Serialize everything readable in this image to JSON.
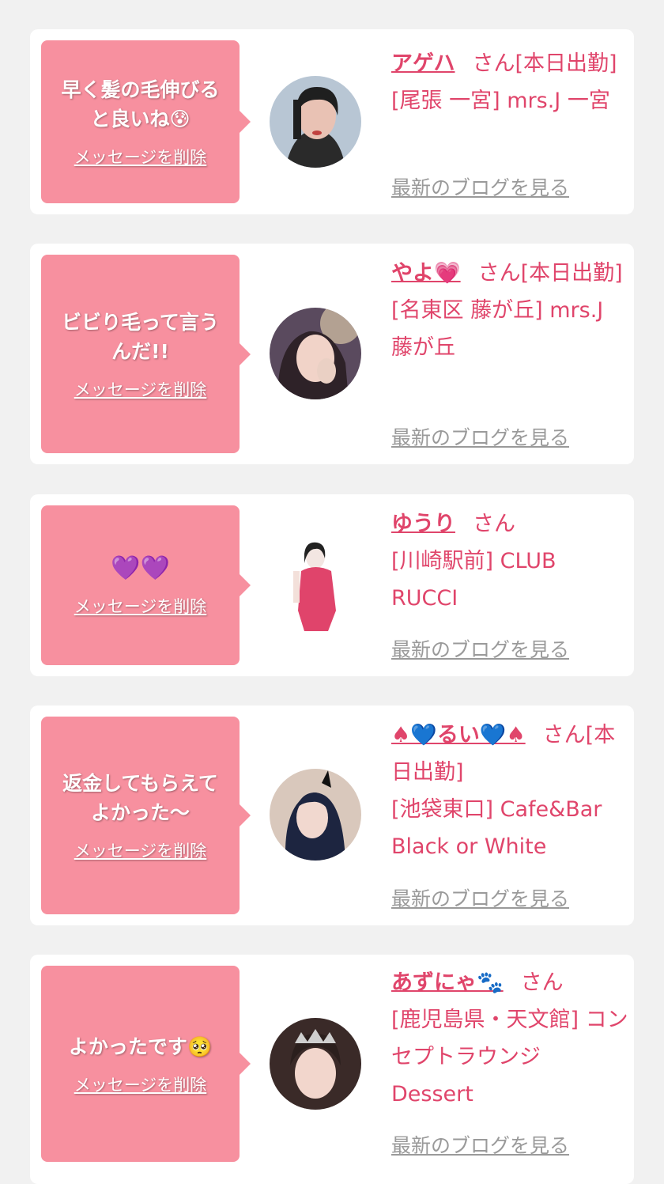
{
  "cards": [
    {
      "message": "早く髪の毛伸びる\nと良いね",
      "message_emoji": "😰",
      "delete_label": "メッセージを削除",
      "name": "アゲハ",
      "name_suffix": "",
      "honorific": "さん[本日出勤]",
      "shop": "[尾張 一宮] mrs.J 一宮",
      "blog_label": "最新のブログを見る"
    },
    {
      "message": "ビビり毛って言う\nんだ!!",
      "message_emoji": "",
      "delete_label": "メッセージを削除",
      "name": "やよ",
      "name_suffix": "💗",
      "honorific": "さん[本日出勤]",
      "shop": "[名東区 藤が丘] mrs.J 藤が丘",
      "blog_label": "最新のブログを見る"
    },
    {
      "message": "",
      "message_emoji": "💜💜",
      "delete_label": "メッセージを削除",
      "name": "ゆうり",
      "name_suffix": "",
      "honorific": "さん",
      "shop": "[川崎駅前] CLUB RUCCI",
      "blog_label": "最新のブログを見る"
    },
    {
      "message": "返金してもらえて\nよかった〜",
      "message_emoji": "",
      "delete_label": "メッセージを削除",
      "name": "♠💙るい💙♠",
      "name_suffix": "",
      "honorific": "さん[本日出勤]",
      "shop": "[池袋東口] Cafe&Bar Black or White",
      "blog_label": "最新のブログを見る"
    },
    {
      "message": "よかったです",
      "message_emoji": "🥺",
      "delete_label": "メッセージを削除",
      "name": "あずにゃ",
      "name_suffix": "🐾",
      "honorific": "さん",
      "shop": "[鹿児島県・天文館] コンセプトラウンジ Dessert",
      "blog_label": "最新のブログを見る"
    }
  ],
  "colors": {
    "page_bg": "#f1f1f1",
    "card_bg": "#ffffff",
    "bubble_pink": "#f7909f",
    "name_pink": "#e0456b",
    "blog_gray": "#9a9a9a"
  }
}
